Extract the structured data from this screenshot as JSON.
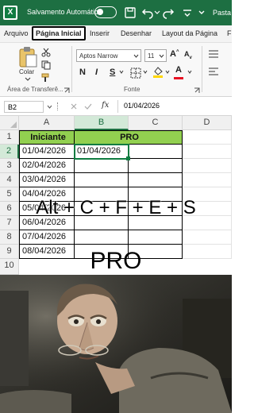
{
  "titlebar": {
    "autosave_label": "Salvamento Automático",
    "doc_title": "Pasta"
  },
  "tabs": [
    {
      "label": "Arquivo",
      "active": false
    },
    {
      "label": "Página Inicial",
      "active": true
    },
    {
      "label": "Inserir",
      "active": false
    },
    {
      "label": "Desenhar",
      "active": false
    },
    {
      "label": "Layout da Página",
      "active": false
    },
    {
      "label": "F",
      "active": false
    }
  ],
  "ribbon": {
    "paste_label": "Colar",
    "clipboard_group": "Área de Transferê...",
    "font_name": "Aptos Narrow",
    "font_size": "11",
    "bold": "N",
    "italic": "I",
    "underline": "S",
    "font_group": "Fonte",
    "grow_font": "A",
    "shrink_font": "A",
    "font_color_letter": "A",
    "font_color": "#e81123",
    "highlight_color": "#ffd700"
  },
  "formula_bar": {
    "name_box": "B2",
    "fx": "fx",
    "content": "01/04/2026"
  },
  "grid": {
    "columns": [
      "A",
      "B",
      "C",
      "D"
    ],
    "rows": [
      "1",
      "2",
      "3",
      "4",
      "5",
      "6",
      "7",
      "8",
      "9",
      "10"
    ],
    "header_row": {
      "a": "Iniciante",
      "bc": "PRO"
    },
    "col_a": [
      "01/04/2026",
      "02/04/2026",
      "03/04/2026",
      "04/04/2026",
      "05/04/2026",
      "06/04/2026",
      "07/04/2026",
      "08/04/2026"
    ],
    "b2": "01/04/2026",
    "header_fill": "#92d050",
    "selection_color": "#107c41"
  },
  "overlay": {
    "shortcut": "Alt + C + F + E + S",
    "pro": "PRO"
  }
}
